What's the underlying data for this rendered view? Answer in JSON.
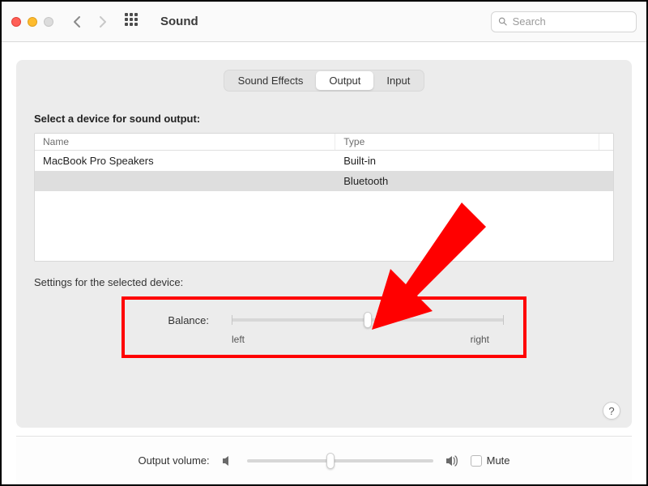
{
  "window": {
    "title": "Sound",
    "search_placeholder": "Search"
  },
  "tabs": {
    "sound_effects": "Sound Effects",
    "output": "Output",
    "input": "Input",
    "active": "output"
  },
  "devices": {
    "heading": "Select a device for sound output:",
    "columns": {
      "name": "Name",
      "type": "Type"
    },
    "rows": [
      {
        "name": "MacBook Pro Speakers",
        "type": "Built-in",
        "selected": false
      },
      {
        "name": "",
        "type": "Bluetooth",
        "selected": true
      }
    ]
  },
  "settings": {
    "heading": "Settings for the selected device:",
    "balance": {
      "label": "Balance:",
      "left_label": "left",
      "right_label": "right",
      "value_percent": 50
    }
  },
  "footer": {
    "output_volume_label": "Output volume:",
    "volume_percent": 45,
    "mute_label": "Mute",
    "mute_checked": false
  },
  "help_label": "?",
  "annotation": {
    "highlight_box": true,
    "arrow": true,
    "arrow_color": "#ff0000"
  }
}
